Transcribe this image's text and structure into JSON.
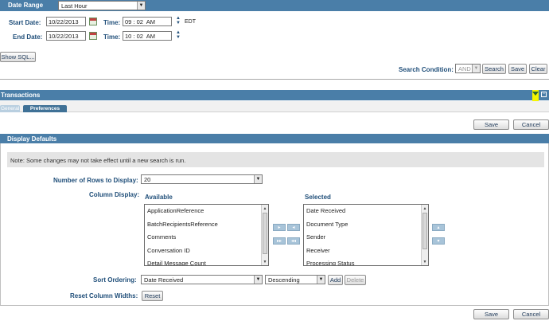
{
  "search": {
    "date_range_label": "Date Range",
    "date_range_value": "Last Hour",
    "start_date_label": "Start Date:",
    "start_date_value": "10/22/2013",
    "end_date_label": "End Date:",
    "end_date_value": "10/22/2013",
    "time_label": "Time:",
    "start_time": "09 : 02  AM",
    "end_time": "10 : 02  AM",
    "timezone": "EDT",
    "show_sql_label": "Show SQL...",
    "condition_label": "Search Condition:",
    "condition_value": "AND",
    "search_label": "Search",
    "save_label": "Save",
    "clear_label": "Clear"
  },
  "transactions": {
    "title": "Transactions",
    "tabs": [
      {
        "label": "General"
      },
      {
        "label": "Preferences"
      }
    ],
    "save_label": "Save",
    "cancel_label": "Cancel"
  },
  "defaults": {
    "title": "Display Defaults",
    "note": "Note: Some changes may not take effect until a new search is run.",
    "rows_label": "Number of Rows to Display:",
    "rows_value": "20",
    "column_display_label": "Column Display:",
    "available_label": "Available",
    "selected_label": "Selected",
    "available": [
      "ApplicationReference",
      "BatchRecipientsReference",
      "Comments",
      "Conversation ID",
      "Detail Message Count"
    ],
    "selected": [
      "Date Received",
      "Document Type",
      "Sender",
      "Receiver",
      "Processing Status"
    ],
    "move_right": "▸",
    "move_left": "◂",
    "move_all_right": "▸▸",
    "move_all_left": "◂◂",
    "move_up": "▴",
    "move_down": "▾",
    "sort_label": "Sort Ordering:",
    "sort_field": "Date Received",
    "sort_direction": "Descending",
    "add_label": "Add",
    "delete_label": "Delete",
    "reset_label": "Reset Column Widths:",
    "reset_button": "Reset",
    "save_label": "Save",
    "cancel_label": "Cancel"
  },
  "icons": {
    "calendar": "calendar-icon",
    "spinner": "spinner-icon",
    "filter": "filter-icon",
    "collapse": "collapse-icon"
  }
}
